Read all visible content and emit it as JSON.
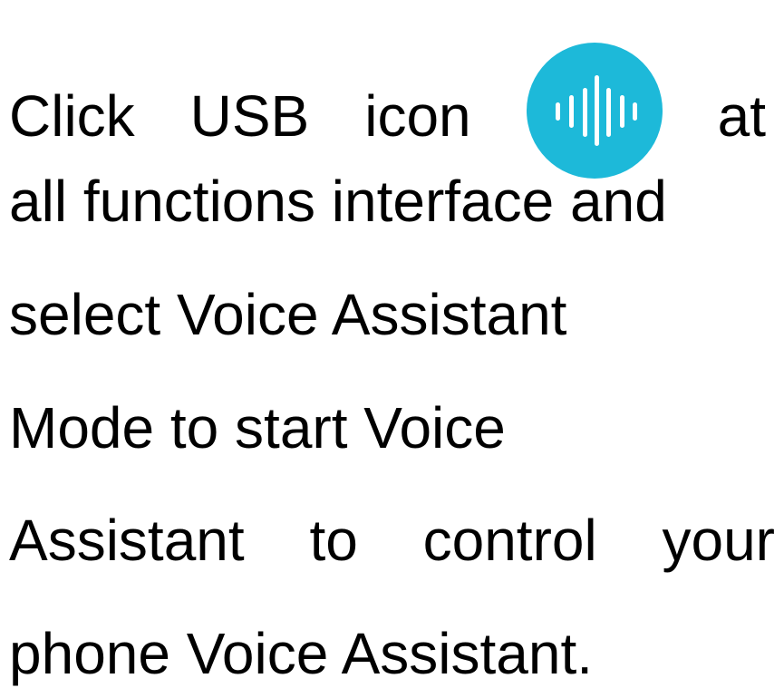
{
  "instruction": {
    "line1": {
      "w1": "Click",
      "w2": "USB",
      "w3": "icon",
      "w4": "at"
    },
    "line2": "all functions interface and",
    "line3": "select Voice Assistant",
    "line4": "Mode to start Voice",
    "line5": {
      "w1": "Assistant",
      "w2": "to",
      "w3": "control",
      "w4": "your"
    },
    "line6": "phone Voice Assistant."
  },
  "icon": {
    "name": "voice-waveform-icon",
    "background_color": "#1db9d9",
    "bar_color": "#ffffff"
  }
}
